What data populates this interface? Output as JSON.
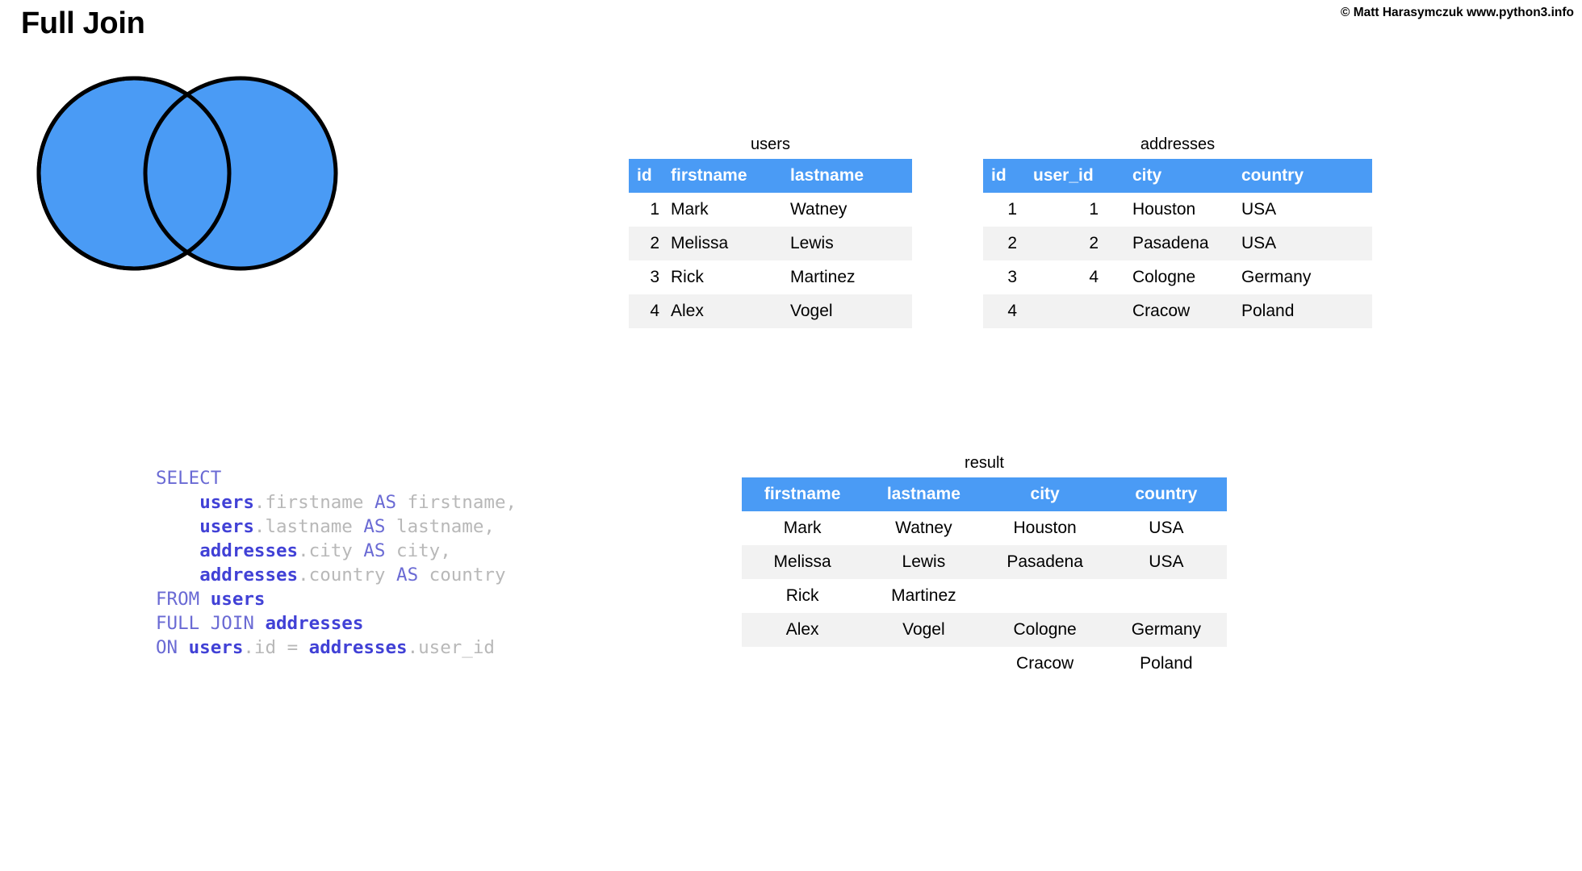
{
  "header": {
    "title": "Full Join",
    "copyright": "© Matt Harasymczuk www.python3.info"
  },
  "venn": {
    "name": "full-join-venn",
    "left_circle_filled": true,
    "right_circle_filled": true,
    "intersection_filled": true,
    "fill_color": "#4a9bf5",
    "stroke_color": "#000000"
  },
  "tables": {
    "users": {
      "caption": "users",
      "headers": [
        "id",
        "firstname",
        "lastname"
      ],
      "rows": [
        [
          "1",
          "Mark",
          "Watney"
        ],
        [
          "2",
          "Melissa",
          "Lewis"
        ],
        [
          "3",
          "Rick",
          "Martinez"
        ],
        [
          "4",
          "Alex",
          "Vogel"
        ]
      ]
    },
    "addresses": {
      "caption": "addresses",
      "headers": [
        "id",
        "user_id",
        "city",
        "country"
      ],
      "rows": [
        [
          "1",
          "1",
          "Houston",
          "USA"
        ],
        [
          "2",
          "2",
          "Pasadena",
          "USA"
        ],
        [
          "3",
          "4",
          "Cologne",
          "Germany"
        ],
        [
          "4",
          "",
          "Cracow",
          "Poland"
        ]
      ]
    },
    "result": {
      "caption": "result",
      "headers": [
        "firstname",
        "lastname",
        "city",
        "country"
      ],
      "rows": [
        [
          "Mark",
          "Watney",
          "Houston",
          "USA"
        ],
        [
          "Melissa",
          "Lewis",
          "Pasadena",
          "USA"
        ],
        [
          "Rick",
          "Martinez",
          "",
          ""
        ],
        [
          "Alex",
          "Vogel",
          "Cologne",
          "Germany"
        ],
        [
          "",
          "",
          "Cracow",
          "Poland"
        ]
      ]
    }
  },
  "sql": {
    "lines": [
      "SELECT",
      "    users.firstname AS firstname,",
      "    users.lastname AS lastname,",
      "    addresses.city AS city,",
      "    addresses.country AS country",
      "FROM users",
      "FULL JOIN addresses",
      "ON users.id = addresses.user_id"
    ]
  },
  "colors": {
    "header_blue": "#4a9bf5",
    "row_alt": "#f2f2f2",
    "keyword": "#6a6ad4",
    "table_name": "#4141d6",
    "field_name": "#b8b8b8"
  }
}
